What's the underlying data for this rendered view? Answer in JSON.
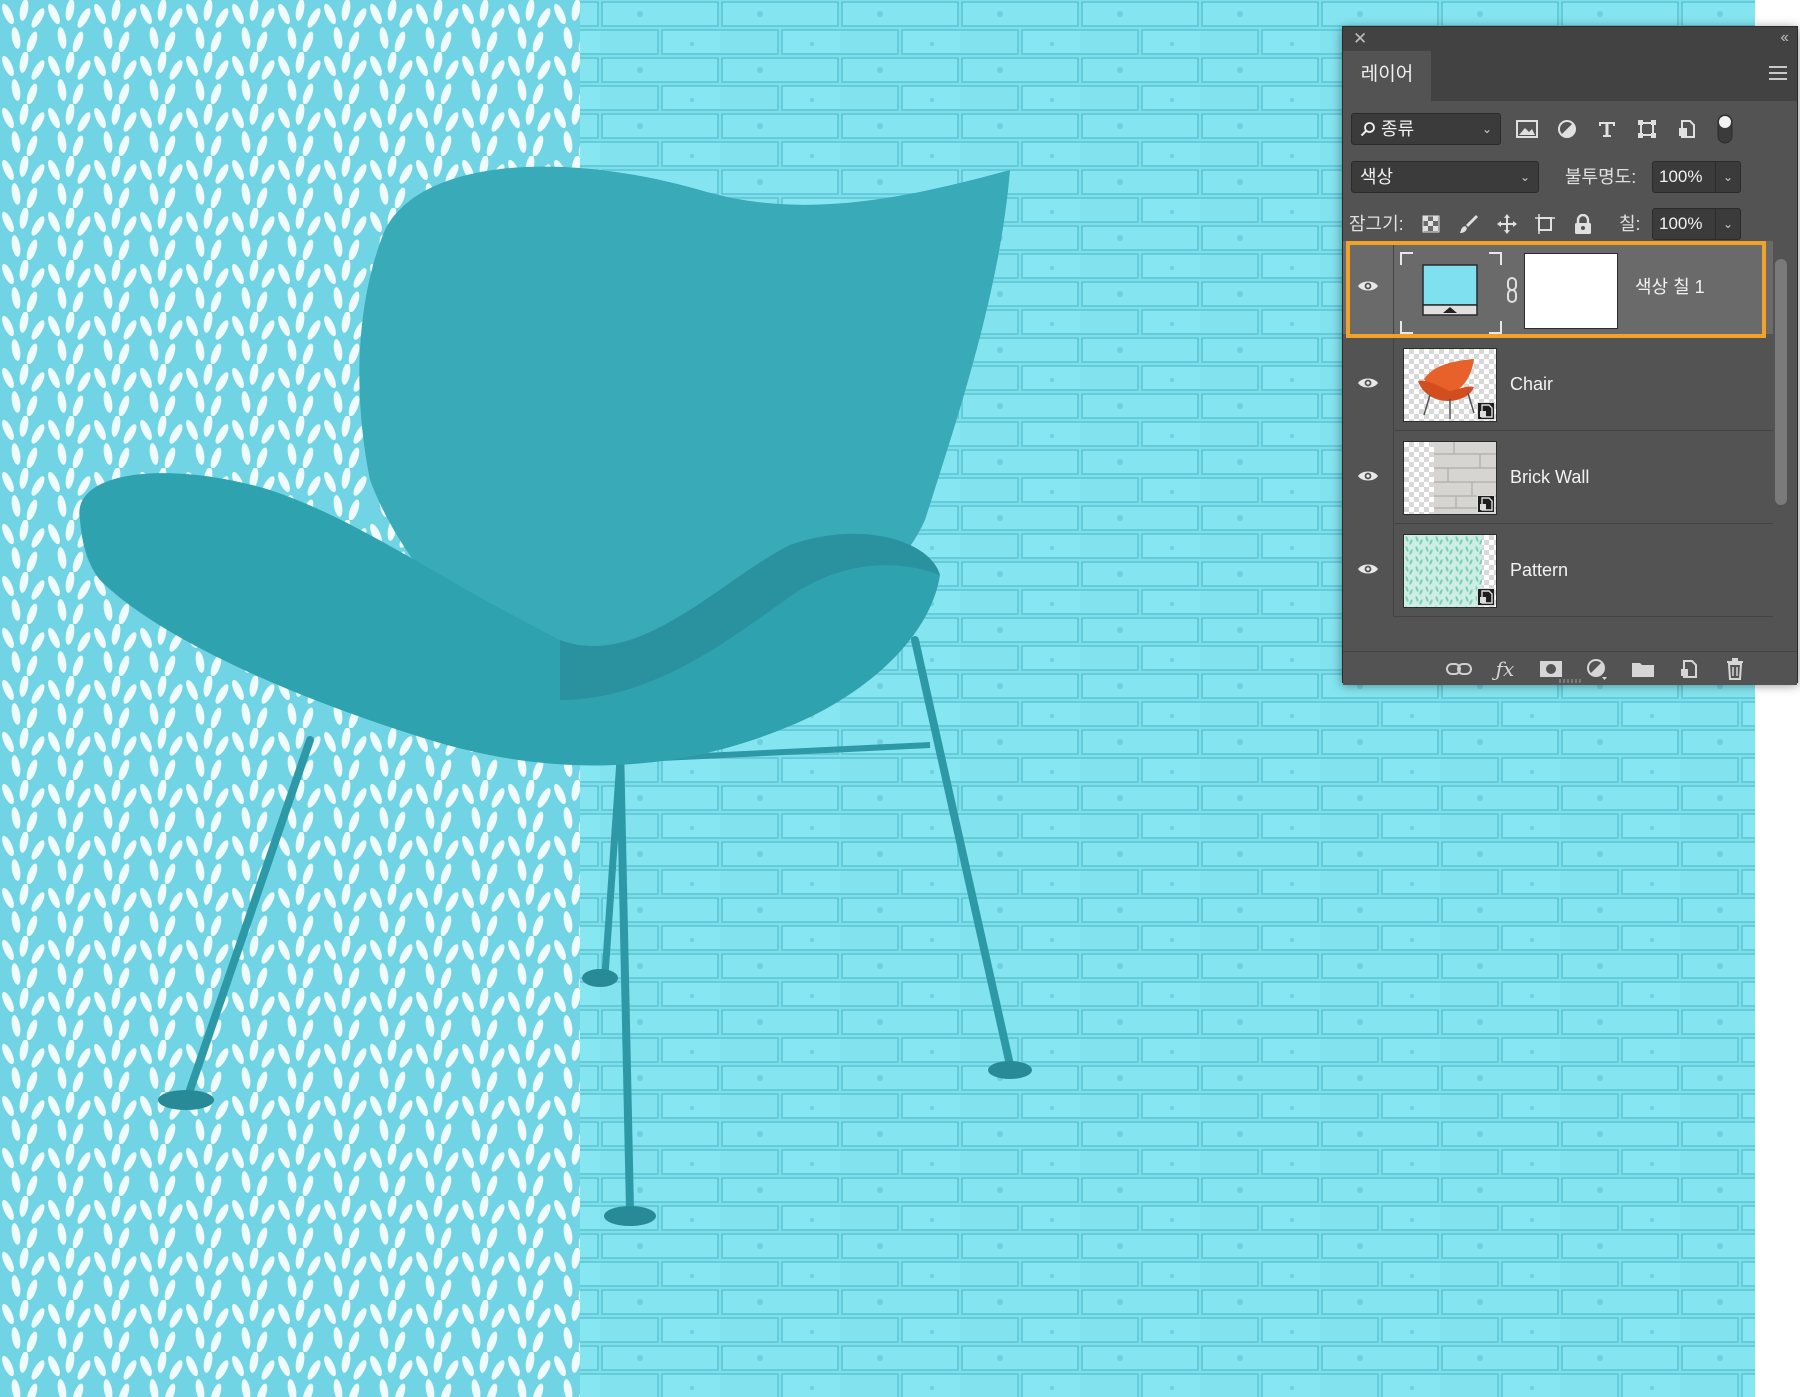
{
  "panel": {
    "tab_label": "레이어",
    "filter": {
      "kind_label": "종류"
    },
    "blend": {
      "mode": "색상",
      "opacity_label": "불투명도:",
      "opacity": "100%"
    },
    "lock": {
      "label": "잠그기:",
      "fill_label": "칠:",
      "fill": "100%"
    },
    "layers": [
      {
        "name": "색상 칠 1",
        "visible": true,
        "selected": true,
        "type": "fill"
      },
      {
        "name": "Chair",
        "visible": true,
        "selected": false,
        "type": "smart-object"
      },
      {
        "name": "Brick Wall",
        "visible": true,
        "selected": false,
        "type": "smart-object"
      },
      {
        "name": "Pattern",
        "visible": true,
        "selected": false,
        "type": "smart-object"
      }
    ],
    "icons": {
      "filter_icons": [
        "image-filter-icon",
        "adjustment-filter-icon",
        "type-filter-icon",
        "shape-filter-icon",
        "smart-object-filter-icon",
        "filter-toggle-icon"
      ],
      "lock_icons": [
        "lock-transparent-icon",
        "lock-paint-icon",
        "lock-position-icon",
        "lock-artboard-icon",
        "lock-all-icon"
      ],
      "bottom_icons": [
        "link-icon",
        "fx-icon",
        "mask-icon",
        "adjustment-icon",
        "folder-icon",
        "new-layer-icon",
        "trash-icon"
      ]
    }
  },
  "colors": {
    "canvas_tint": "#7ee0ec",
    "pattern_bg": "#6fd3e3",
    "chair": "#2a9aa8",
    "fill_swatch": "#7fe1ef",
    "selection_accent": "#f2a22b",
    "panel_bg": "#535353"
  }
}
